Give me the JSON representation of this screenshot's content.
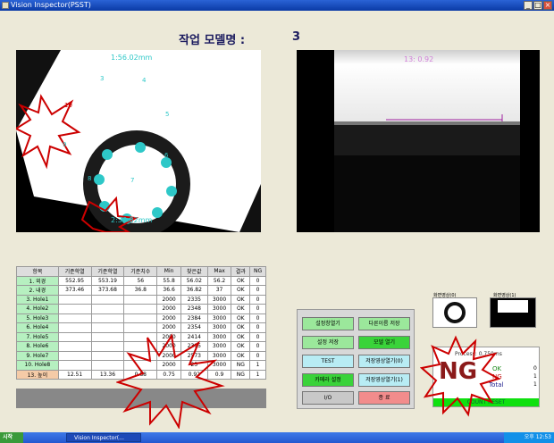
{
  "window": {
    "title": "Vision Inspector(PSST)"
  },
  "model": {
    "label": "작업 모델명 :",
    "value": "3"
  },
  "cam1": {
    "dim_top": "1:56.02mm",
    "dim_bottom": "2:36.82mm",
    "holes": [
      "3",
      "4",
      "5",
      "6",
      "7",
      "8",
      "9",
      "10"
    ]
  },
  "cam2": {
    "overlay": "13: 0.92"
  },
  "table": {
    "headers": [
      "항목",
      "기준학열",
      "기준학열",
      "기준치수",
      "Min",
      "찾은값",
      "Max",
      "결과",
      "NG"
    ],
    "rows": [
      [
        "1. 외경",
        "552.95",
        "553.19",
        "56",
        "55.8",
        "56.02",
        "56.2",
        "OK",
        "0"
      ],
      [
        "2. 내경",
        "373.46",
        "373.68",
        "36.8",
        "36.6",
        "36.82",
        "37",
        "OK",
        "0"
      ],
      [
        "3. Hole1",
        "",
        "",
        "",
        "2000",
        "2335",
        "3000",
        "OK",
        "0"
      ],
      [
        "4. Hole2",
        "",
        "",
        "",
        "2000",
        "2348",
        "3000",
        "OK",
        "0"
      ],
      [
        "5. Hole3",
        "",
        "",
        "",
        "2000",
        "2384",
        "3000",
        "OK",
        "0"
      ],
      [
        "6. Hole4",
        "",
        "",
        "",
        "2000",
        "2354",
        "3000",
        "OK",
        "0"
      ],
      [
        "7. Hole5",
        "",
        "",
        "",
        "2000",
        "2414",
        "3000",
        "OK",
        "0"
      ],
      [
        "8. Hole6",
        "",
        "",
        "",
        "2000",
        "2395",
        "3000",
        "OK",
        "0"
      ],
      [
        "9. Hole7",
        "",
        "",
        "",
        "2000",
        "2573",
        "3000",
        "OK",
        "0"
      ],
      [
        "10. Hole8",
        "",
        "",
        "",
        "2000",
        "25",
        "3000",
        "NG",
        "1"
      ],
      [
        "13. 높이",
        "12.51",
        "13.36",
        "0.88",
        "0.75",
        "0.92",
        "0.9",
        "NG",
        "1"
      ]
    ]
  },
  "buttons": {
    "settings_open": "설정창열기",
    "save_other": "다른이름 저장",
    "save_settings": "설정 저장",
    "open_model": "모델 열기",
    "test": "TEST",
    "save_image0": "저장영상열기(0)",
    "camera_setup": "카메라 설정",
    "save_image1": "저장영상열기(1)",
    "io": "I/O",
    "exit": "종 료"
  },
  "thumbs": {
    "t0": "화면영상(0)",
    "t1": "화면영상(1)"
  },
  "result": {
    "process": "Process: 0.750ms",
    "status": "NG",
    "ok_label": "OK",
    "ok_val": "0",
    "ng_label": "NG",
    "ng_val": "1",
    "total_label": "Total",
    "total_val": "1",
    "reset": "COUNT RESET",
    "status_color": "#8b1a1a"
  },
  "taskbar": {
    "start": "시작",
    "task": "Vision Inspector(...",
    "clock": "오후 12:53"
  }
}
